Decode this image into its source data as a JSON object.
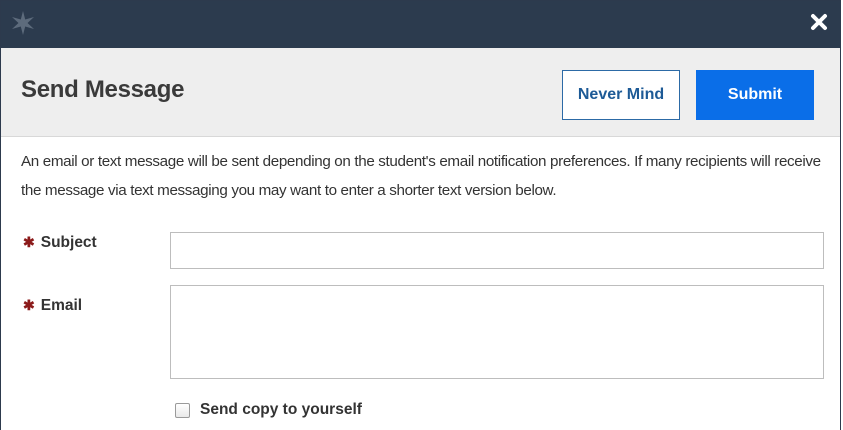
{
  "titlebar": {
    "logo_icon": "star-logo-icon",
    "close_icon": "close-icon",
    "background": "#2c3b4e"
  },
  "header": {
    "title": "Send Message",
    "never_mind_label": "Never Mind",
    "submit_label": "Submit",
    "submit_color": "#0a6ee8"
  },
  "description": "An email or text message will be sent depending on the student's email notification preferences. If many recipients will receive the message via text messaging you may want to enter a shorter text version below.",
  "form": {
    "required_marker": "✱",
    "subject": {
      "label": "Subject",
      "value": ""
    },
    "email": {
      "label": "Email",
      "value": ""
    },
    "send_copy": {
      "label": "Send copy to yourself",
      "checked": false
    }
  }
}
